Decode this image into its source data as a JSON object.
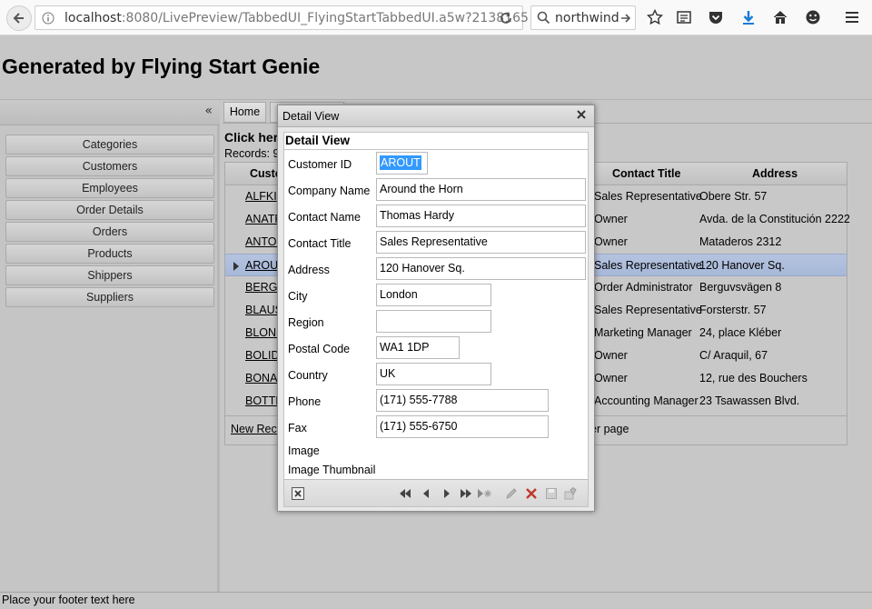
{
  "browser": {
    "url_host": "localhost",
    "url_rest": ":8080/LivePreview/TabbedUI_FlyingStartTabbedUI.a5w?2138165",
    "search_value": "northwind"
  },
  "app": {
    "title": "Generated by Flying Start Genie",
    "collapse_glyph": "«",
    "footer_text": "Place your footer text here"
  },
  "sidebar": {
    "items": [
      {
        "label": "Categories"
      },
      {
        "label": "Customers"
      },
      {
        "label": "Employees"
      },
      {
        "label": "Order Details"
      },
      {
        "label": "Orders"
      },
      {
        "label": "Products"
      },
      {
        "label": "Shippers"
      },
      {
        "label": "Suppliers"
      }
    ]
  },
  "main": {
    "tab_home": "Home",
    "click_here": "Click here",
    "records_label": "Records:",
    "records_count": "9",
    "new_record": "New Reco",
    "per_page": "er page",
    "grid": {
      "headers": {
        "id": "Custo",
        "contact_title": "Contact Title",
        "address": "Address"
      },
      "rows": [
        {
          "id": "ALFKI",
          "title": "Sales Representative",
          "address": "Obere Str. 57",
          "selected": false
        },
        {
          "id": "ANATR",
          "title": "Owner",
          "address": "Avda. de la Constitución 2222",
          "selected": false
        },
        {
          "id": "ANTON",
          "title": "Owner",
          "address": "Mataderos 2312",
          "selected": false
        },
        {
          "id": "AROUT",
          "title": "Sales Representative",
          "address": "120 Hanover Sq.",
          "selected": true
        },
        {
          "id": "BERGS",
          "title": "Order Administrator",
          "address": "Berguvsvägen 8",
          "selected": false
        },
        {
          "id": "BLAUS",
          "title": "Sales Representative",
          "address": "Forsterstr. 57",
          "selected": false
        },
        {
          "id": "BLONP",
          "title": "Marketing Manager",
          "address": "24, place Kléber",
          "selected": false
        },
        {
          "id": "BOLID",
          "title": "Owner",
          "address": "C/ Araquil, 67",
          "selected": false
        },
        {
          "id": "BONAP",
          "title": "Owner",
          "address": "12, rue des Bouchers",
          "selected": false
        },
        {
          "id": "BOTTM",
          "title": "Accounting Manager",
          "address": "23 Tsawassen Blvd.",
          "selected": false
        }
      ]
    }
  },
  "dialog": {
    "window_title": "Detail View",
    "heading": "Detail View",
    "fields": {
      "customer_id": {
        "label": "Customer ID",
        "value": "AROUT"
      },
      "company_name": {
        "label": "Company Name",
        "value": "Around the Horn"
      },
      "contact_name": {
        "label": "Contact Name",
        "value": "Thomas Hardy"
      },
      "contact_title": {
        "label": "Contact Title",
        "value": "Sales Representative"
      },
      "address": {
        "label": "Address",
        "value": "120 Hanover Sq."
      },
      "city": {
        "label": "City",
        "value": "London"
      },
      "region": {
        "label": "Region",
        "value": ""
      },
      "postal_code": {
        "label": "Postal Code",
        "value": "WA1 1DP"
      },
      "country": {
        "label": "Country",
        "value": "UK"
      },
      "phone": {
        "label": "Phone",
        "value": "(171) 555-7788"
      },
      "fax": {
        "label": "Fax",
        "value": "(171) 555-6750"
      },
      "image": {
        "label": "Image"
      },
      "image_thumbnail": {
        "label": "Image Thumbnail"
      }
    },
    "toolbar_icons": [
      "close-record-icon",
      "first-record-icon",
      "previous-record-icon",
      "next-record-icon",
      "last-record-icon",
      "new-record-icon",
      "edit-record-icon",
      "delete-record-icon",
      "save-record-icon",
      "undo-record-icon"
    ]
  },
  "colors": {
    "page_bg": "#c8c7c8",
    "selected_row": "#a7b8d8",
    "selection_highlight": "#3399ff",
    "download_blue": "#1a7ad9",
    "delete_red": "#c0392b"
  }
}
